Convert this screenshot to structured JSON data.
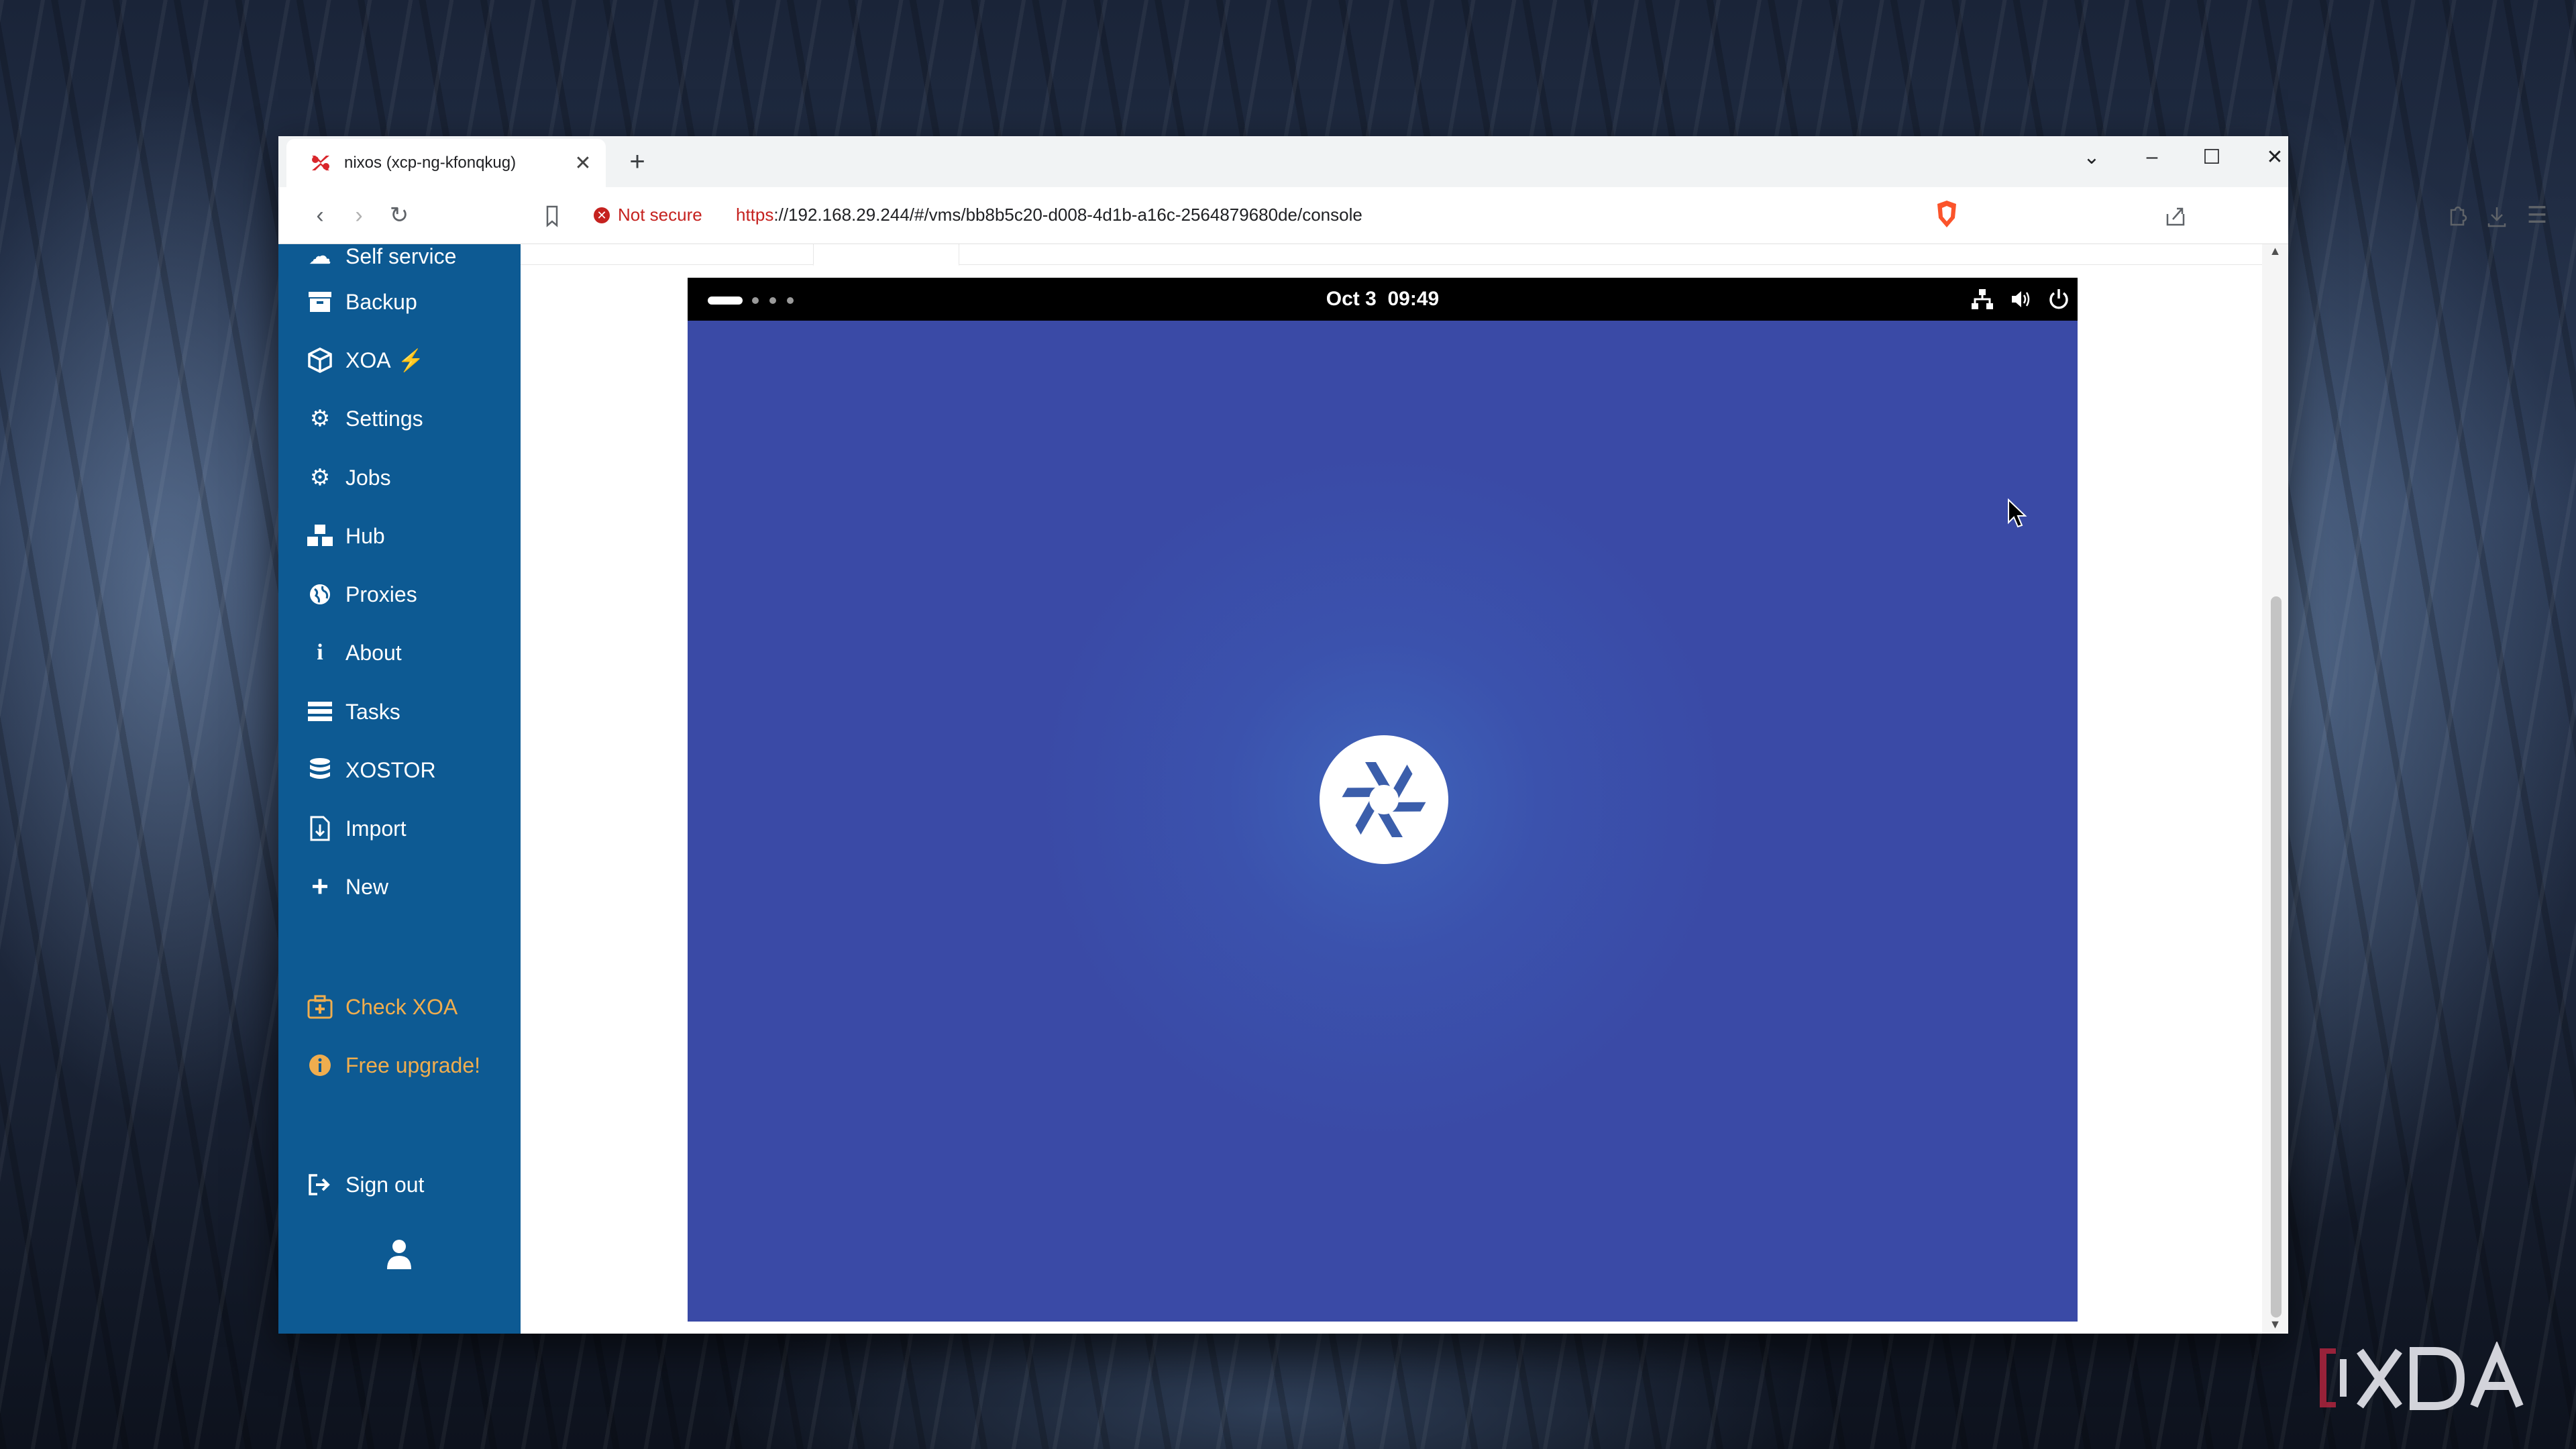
{
  "browser": {
    "tab_title": "nixos (xcp-ng-kfonqkug)",
    "tab_close": "✕",
    "new_tab": "+",
    "security_label": "Not secure",
    "url_scheme": "https",
    "url_rest": "://192.168.29.244/#/vms/bb8b5c20-d008-4d1b-a16c-2564879680de/console"
  },
  "sidebar": {
    "items": [
      {
        "label": "Self service",
        "icon": "cloud-icon"
      },
      {
        "label": "Backup",
        "icon": "archive-icon"
      },
      {
        "label": "XOA",
        "icon": "cube-icon"
      },
      {
        "label": "Settings",
        "icon": "gear-icon"
      },
      {
        "label": "Jobs",
        "icon": "gears-icon"
      },
      {
        "label": "Hub",
        "icon": "cubes-icon"
      },
      {
        "label": "Proxies",
        "icon": "globe-icon"
      },
      {
        "label": "About",
        "icon": "info-icon"
      },
      {
        "label": "Tasks",
        "icon": "list-icon"
      },
      {
        "label": "XOSTOR",
        "icon": "database-icon"
      },
      {
        "label": "Import",
        "icon": "file-import-icon"
      },
      {
        "label": "New",
        "icon": "plus-icon"
      }
    ],
    "check_xoa": "Check XOA",
    "free_upgrade": "Free upgrade!",
    "sign_out": "Sign out"
  },
  "console": {
    "date": "Oct 3",
    "time": "09:49"
  },
  "colors": {
    "sidebar_bg": "#0d5a93",
    "warning": "#f0ad4e",
    "console_bg": "#3a4aa6",
    "insecure_red": "#c5221f"
  }
}
